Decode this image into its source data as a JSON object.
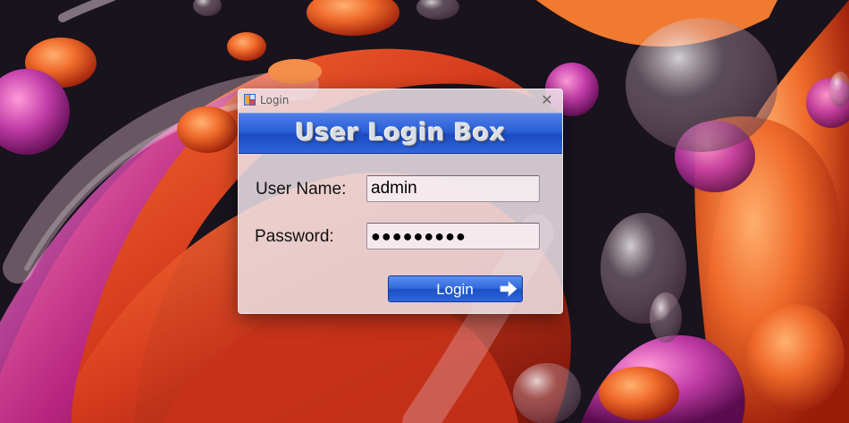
{
  "window": {
    "title": "Login",
    "close_glyph": "✕"
  },
  "banner": {
    "title": "User Login Box"
  },
  "form": {
    "username_label": "User Name:",
    "username_value": "admin",
    "password_label": "Password:",
    "password_value": "●●●●●●●●●"
  },
  "actions": {
    "login_label": "Login",
    "login_icon": "arrow-right-icon"
  },
  "colors": {
    "banner_blue": "#2a5fd6",
    "button_blue": "#3169dc",
    "window_bg": "#eee2e8"
  }
}
